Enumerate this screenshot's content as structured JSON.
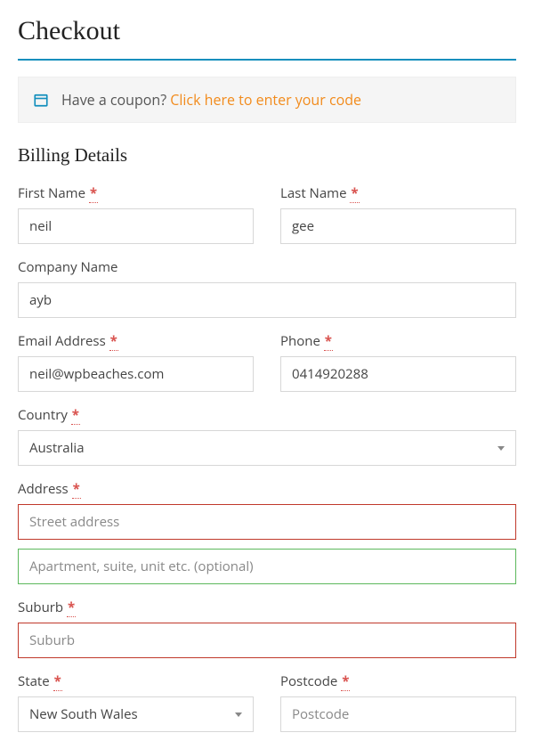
{
  "page": {
    "title": "Checkout"
  },
  "coupon": {
    "question": "Have a coupon? ",
    "link_text": "Click here to enter your code"
  },
  "section": {
    "billing_title": "Billing Details"
  },
  "fields": {
    "first_name": {
      "label": "First Name",
      "value": "neil",
      "required": true
    },
    "last_name": {
      "label": "Last Name",
      "value": "gee",
      "required": true
    },
    "company": {
      "label": "Company Name",
      "value": "ayb",
      "required": false
    },
    "email": {
      "label": "Email Address",
      "value": "neil@wpbeaches.com",
      "required": true
    },
    "phone": {
      "label": "Phone",
      "value": "0414920288",
      "required": true
    },
    "country": {
      "label": "Country",
      "value": "Australia",
      "required": true
    },
    "address": {
      "label": "Address",
      "required": true,
      "line1_placeholder": "Street address",
      "line2_placeholder": "Apartment, suite, unit etc. (optional)"
    },
    "suburb": {
      "label": "Suburb",
      "placeholder": "Suburb",
      "required": true
    },
    "state": {
      "label": "State",
      "value": "New South Wales",
      "required": true
    },
    "postcode": {
      "label": "Postcode",
      "placeholder": "Postcode",
      "required": true
    }
  },
  "required_mark": "*"
}
